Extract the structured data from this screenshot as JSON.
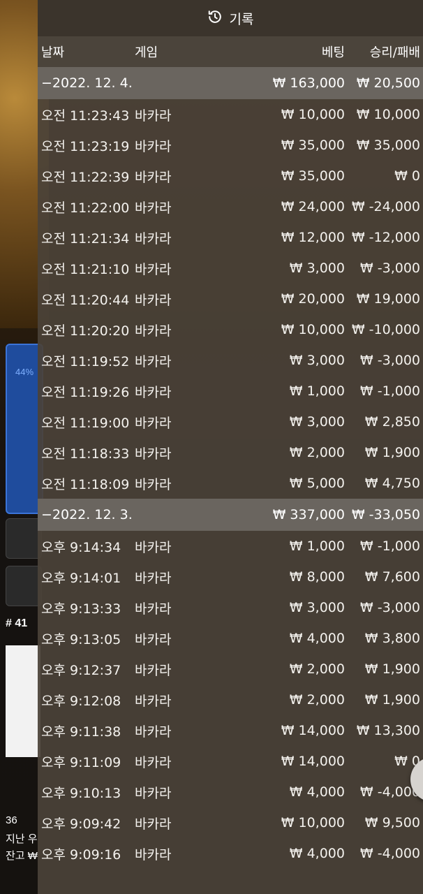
{
  "background": {
    "percent": "44%",
    "room_no": "# 41",
    "stats": [
      "36",
      "지난 우",
      "잔고 ₩"
    ]
  },
  "history": {
    "title": "기록",
    "icon": "history-icon",
    "columns": {
      "date": "날짜",
      "game": "게임",
      "bet": "베팅",
      "result": "승리/패배"
    },
    "groups": [
      {
        "date": "−2022. 12. 4.",
        "total_bet": "₩ 163,000",
        "total_result": "₩ 20,500",
        "rows": [
          {
            "time": "오전 11:23:43",
            "game": "바카라",
            "bet": "₩ 10,000",
            "result": "₩ 10,000"
          },
          {
            "time": "오전 11:23:19",
            "game": "바카라",
            "bet": "₩ 35,000",
            "result": "₩ 35,000"
          },
          {
            "time": "오전 11:22:39",
            "game": "바카라",
            "bet": "₩ 35,000",
            "result": "₩ 0"
          },
          {
            "time": "오전 11:22:00",
            "game": "바카라",
            "bet": "₩ 24,000",
            "result": "₩ -24,000"
          },
          {
            "time": "오전 11:21:34",
            "game": "바카라",
            "bet": "₩ 12,000",
            "result": "₩ -12,000"
          },
          {
            "time": "오전 11:21:10",
            "game": "바카라",
            "bet": "₩ 3,000",
            "result": "₩ -3,000"
          },
          {
            "time": "오전 11:20:44",
            "game": "바카라",
            "bet": "₩ 20,000",
            "result": "₩ 19,000"
          },
          {
            "time": "오전 11:20:20",
            "game": "바카라",
            "bet": "₩ 10,000",
            "result": "₩ -10,000"
          },
          {
            "time": "오전 11:19:52",
            "game": "바카라",
            "bet": "₩ 3,000",
            "result": "₩ -3,000"
          },
          {
            "time": "오전 11:19:26",
            "game": "바카라",
            "bet": "₩ 1,000",
            "result": "₩ -1,000"
          },
          {
            "time": "오전 11:19:00",
            "game": "바카라",
            "bet": "₩ 3,000",
            "result": "₩ 2,850"
          },
          {
            "time": "오전 11:18:33",
            "game": "바카라",
            "bet": "₩ 2,000",
            "result": "₩ 1,900"
          },
          {
            "time": "오전 11:18:09",
            "game": "바카라",
            "bet": "₩ 5,000",
            "result": "₩ 4,750"
          }
        ]
      },
      {
        "date": "−2022. 12. 3.",
        "total_bet": "₩ 337,000",
        "total_result": "₩ -33,050",
        "rows": [
          {
            "time": "오후 9:14:34",
            "game": "바카라",
            "bet": "₩ 1,000",
            "result": "₩ -1,000"
          },
          {
            "time": "오후 9:14:01",
            "game": "바카라",
            "bet": "₩ 8,000",
            "result": "₩ 7,600"
          },
          {
            "time": "오후 9:13:33",
            "game": "바카라",
            "bet": "₩ 3,000",
            "result": "₩ -3,000"
          },
          {
            "time": "오후 9:13:05",
            "game": "바카라",
            "bet": "₩ 4,000",
            "result": "₩ 3,800"
          },
          {
            "time": "오후 9:12:37",
            "game": "바카라",
            "bet": "₩ 2,000",
            "result": "₩ 1,900"
          },
          {
            "time": "오후 9:12:08",
            "game": "바카라",
            "bet": "₩ 2,000",
            "result": "₩ 1,900"
          },
          {
            "time": "오후 9:11:38",
            "game": "바카라",
            "bet": "₩ 14,000",
            "result": "₩ 13,300"
          },
          {
            "time": "오후 9:11:09",
            "game": "바카라",
            "bet": "₩ 14,000",
            "result": "₩ 0"
          },
          {
            "time": "오후 9:10:13",
            "game": "바카라",
            "bet": "₩ 4,000",
            "result": "₩ -4,000"
          },
          {
            "time": "오후 9:09:42",
            "game": "바카라",
            "bet": "₩ 10,000",
            "result": "₩ 9,500"
          },
          {
            "time": "오후 9:09:16",
            "game": "바카라",
            "bet": "₩ 4,000",
            "result": "₩ -4,000"
          }
        ]
      }
    ],
    "close_icon": "close-icon"
  }
}
